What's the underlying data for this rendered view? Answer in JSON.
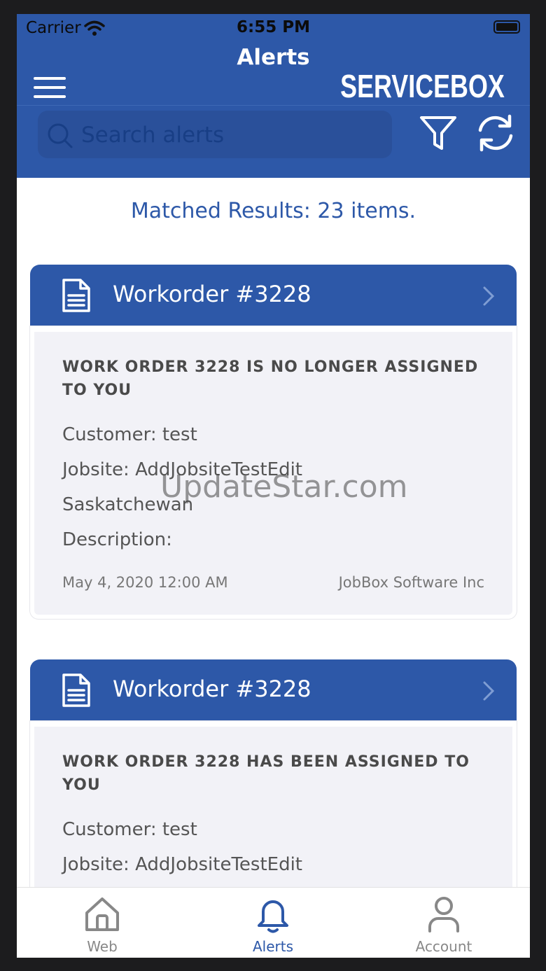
{
  "status_bar": {
    "carrier": "Carrier",
    "time": "6:55 PM"
  },
  "header": {
    "title": "Alerts",
    "brand": "SERVICEBOX"
  },
  "search": {
    "placeholder": "Search alerts"
  },
  "matched_text": "Matched Results: 23 items.",
  "cards": [
    {
      "header": "Workorder #3228",
      "headline": "WORK ORDER 3228 IS NO LONGER ASSIGNED TO YOU",
      "customer": "Customer: test",
      "jobsite": "Jobsite: AddJobsiteTestEdit",
      "region": "Saskatchewan",
      "description": "Description:",
      "date": "May 4, 2020 12:00 AM",
      "company": "JobBox Software Inc"
    },
    {
      "header": "Workorder #3228",
      "headline": "WORK ORDER 3228 HAS BEEN ASSIGNED TO YOU",
      "customer": "Customer: test",
      "jobsite": "Jobsite: AddJobsiteTestEdit"
    }
  ],
  "watermark": "UpdateStar.com",
  "tabs": [
    {
      "label": "Web",
      "icon": "home-icon"
    },
    {
      "label": "Alerts",
      "icon": "bell-icon",
      "active": true
    },
    {
      "label": "Account",
      "icon": "person-icon"
    }
  ],
  "colors": {
    "primary": "#2d58a8",
    "card_bg": "#f2f2f7",
    "inactive": "#888888"
  }
}
